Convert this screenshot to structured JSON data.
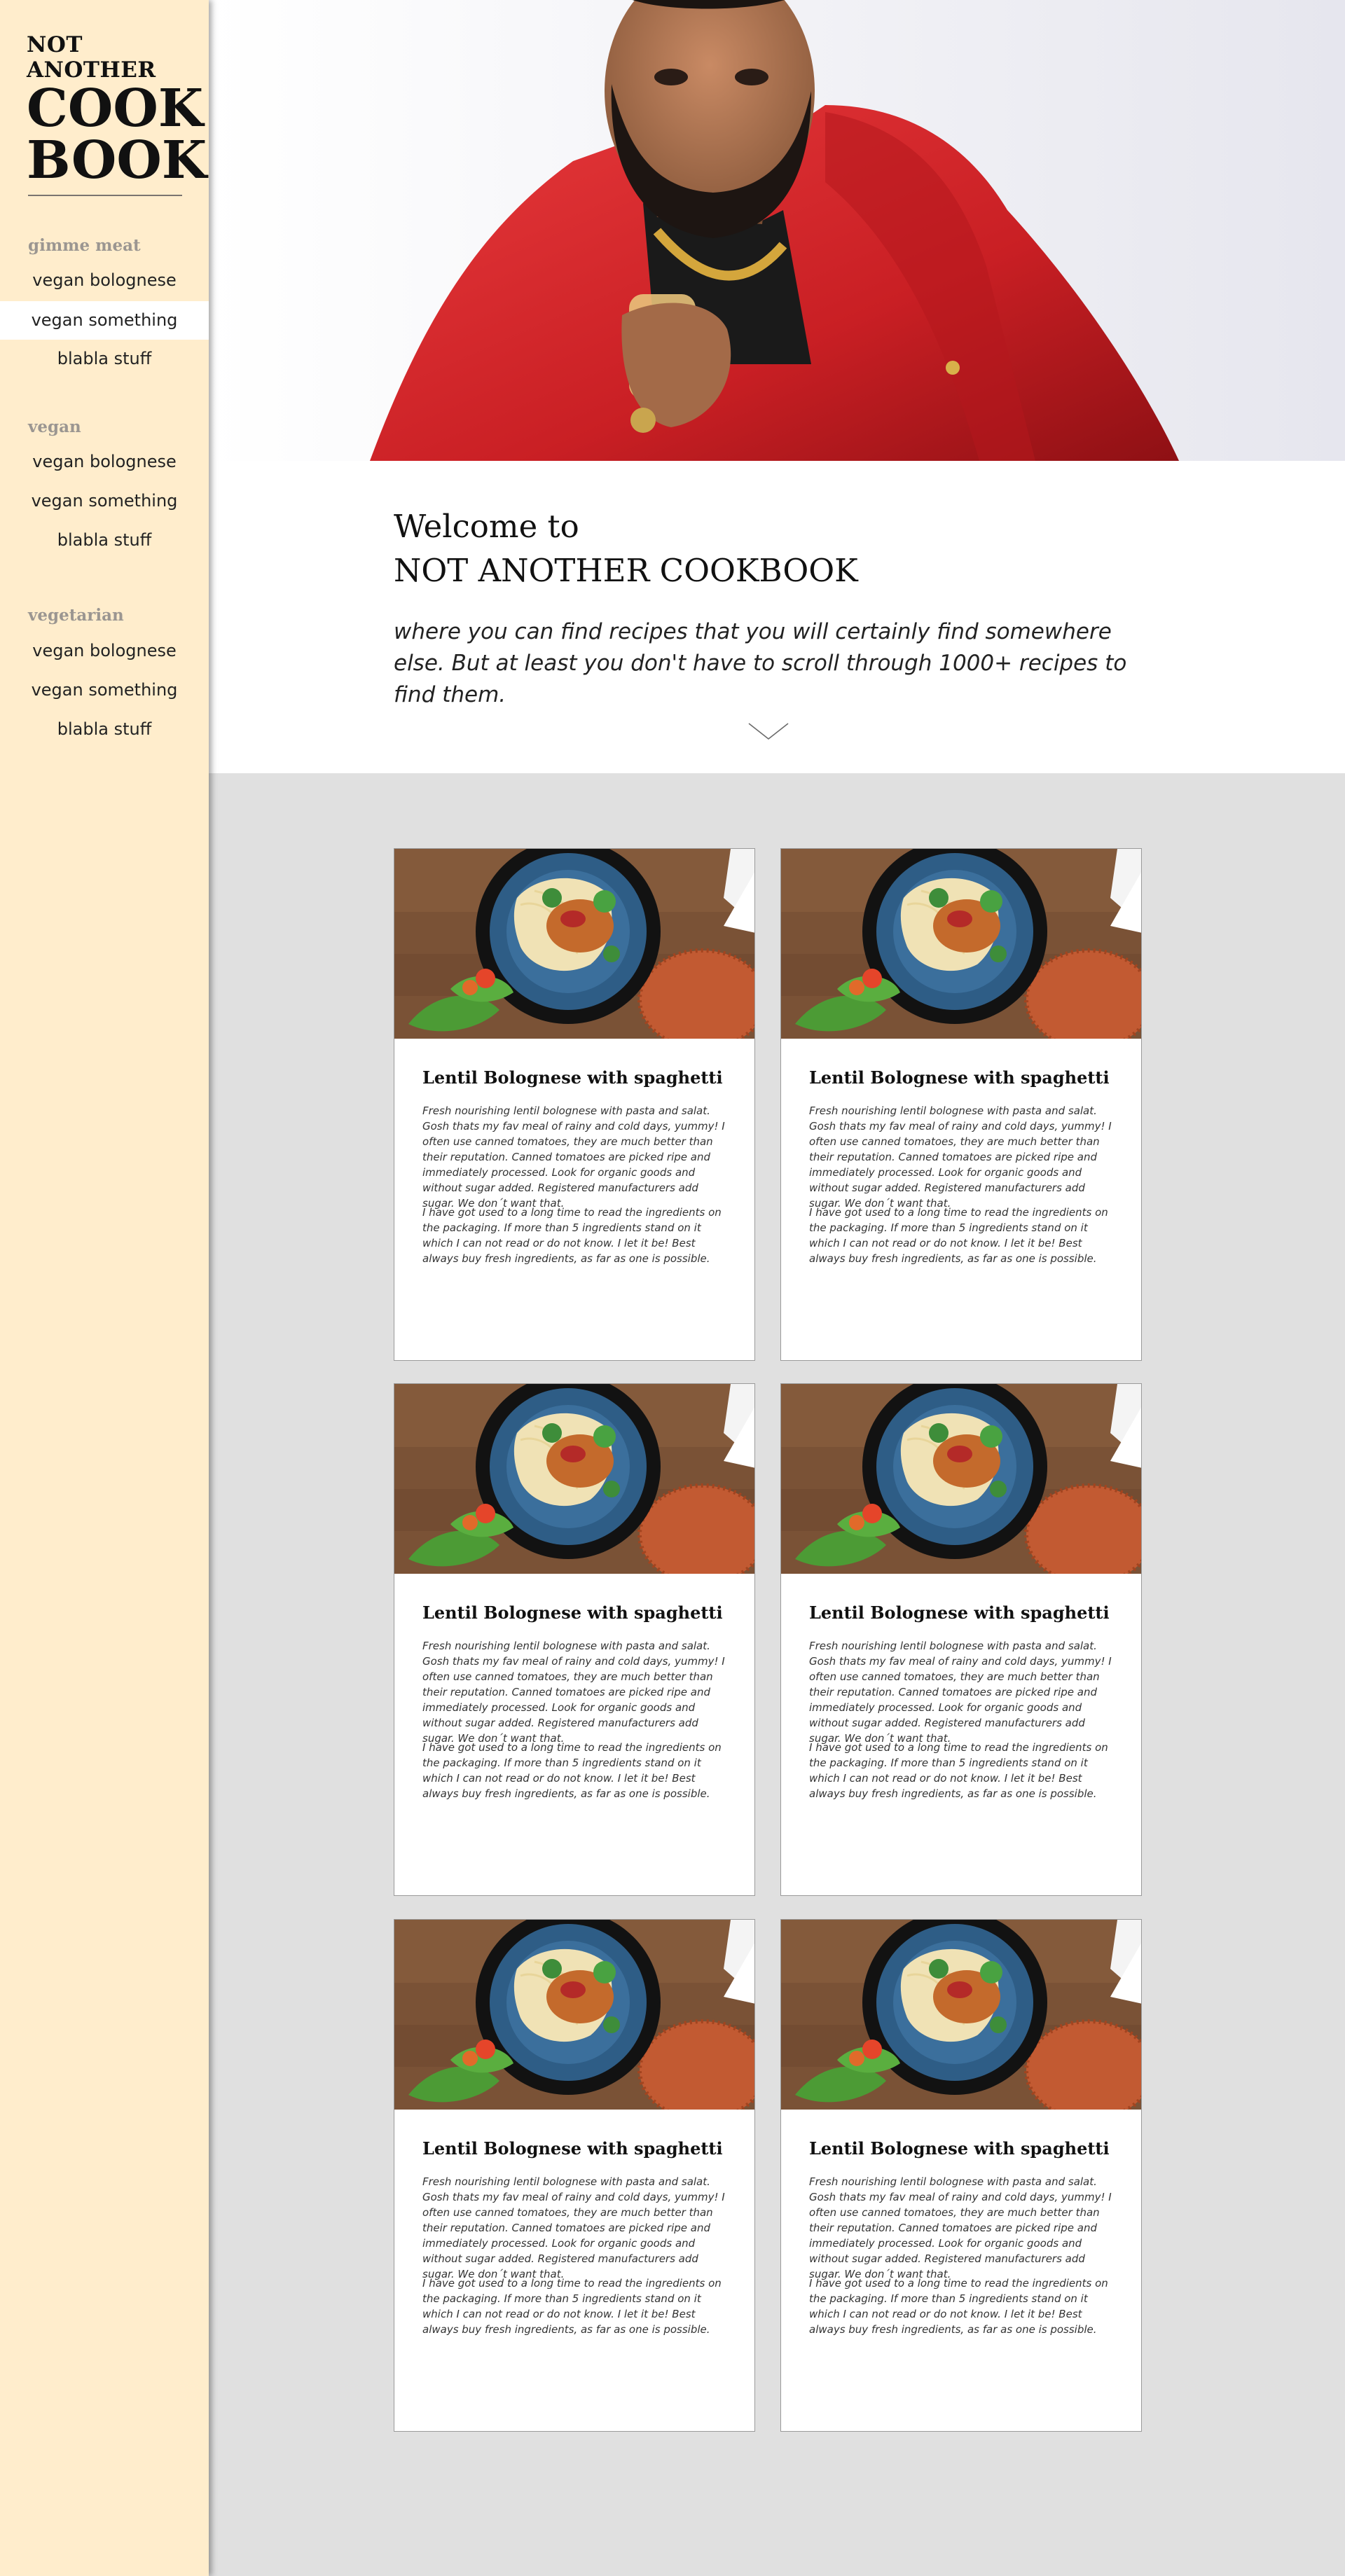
{
  "sidebar": {
    "logo": {
      "line1": "NOT ANOTHER",
      "line2": "COOK",
      "line3": "BOOK"
    },
    "sections": [
      {
        "heading": "gimme meat",
        "items": [
          {
            "label": "vegan bolognese"
          },
          {
            "label": "vegan something"
          },
          {
            "label": "blabla stuff"
          }
        ]
      },
      {
        "heading": "vegan",
        "items": [
          {
            "label": "vegan bolognese"
          },
          {
            "label": "vegan something"
          },
          {
            "label": "blabla stuff"
          }
        ]
      },
      {
        "heading": "vegetarian",
        "items": [
          {
            "label": "vegan bolognese"
          },
          {
            "label": "vegan something"
          },
          {
            "label": "blabla stuff"
          }
        ]
      }
    ],
    "active_item": "vegan something"
  },
  "welcome": {
    "line1": "Welcome to",
    "line2": "NOT ANOTHER COOKBOOK",
    "subtitle": "where you can find recipes that you will certainly find somewhere else. But at least you don't have to scroll through 1000+ recipes to find them."
  },
  "cards": [
    {
      "title": "Lentil Bolognese with spaghetti",
      "p1": "Fresh nourishing lentil bolognese with pasta and salat. Gosh thats my fav meal of rainy and cold days, yummy! I often use canned tomatoes, they are much better than their reputation. Canned tomatoes are picked ripe and immediately processed. Look for organic goods and without sugar added. Registered manufacturers add sugar. We don´t want that.",
      "p2": "I have got used to a long time to read the ingredients on the packaging. If more than 5 ingredients stand on it which I can not read or do not know. I let it be! Best always buy fresh ingredients, as far as one is possible."
    },
    {
      "title": "Lentil Bolognese with spaghetti",
      "p1": "Fresh nourishing lentil bolognese with pasta and salat. Gosh thats my fav meal of rainy and cold days, yummy! I often use canned tomatoes, they are much better than their reputation. Canned tomatoes are picked ripe and immediately processed. Look for organic goods and without sugar added. Registered manufacturers add sugar. We don´t want that.",
      "p2": "I have got used to a long time to read the ingredients on the packaging. If more than 5 ingredients stand on it which I can not read or do not know. I let it be! Best always buy fresh ingredients, as far as one is possible."
    },
    {
      "title": "Lentil Bolognese with spaghetti",
      "p1": "Fresh nourishing lentil bolognese with pasta and salat. Gosh thats my fav meal of rainy and cold days, yummy! I often use canned tomatoes, they are much better than their reputation. Canned tomatoes are picked ripe and immediately processed. Look for organic goods and without sugar added. Registered manufacturers add sugar. We don´t want that.",
      "p2": "I have got used to a long time to read the ingredients on the packaging. If more than 5 ingredients stand on it which I can not read or do not know. I let it be! Best always buy fresh ingredients, as far as one is possible."
    },
    {
      "title": "Lentil Bolognese with spaghetti",
      "p1": "Fresh nourishing lentil bolognese with pasta and salat. Gosh thats my fav meal of rainy and cold days, yummy! I often use canned tomatoes, they are much better than their reputation. Canned tomatoes are picked ripe and immediately processed. Look for organic goods and without sugar added. Registered manufacturers add sugar. We don´t want that.",
      "p2": "I have got used to a long time to read the ingredients on the packaging. If more than 5 ingredients stand on it which I can not read or do not know. I let it be! Best always buy fresh ingredients, as far as one is possible."
    },
    {
      "title": "Lentil Bolognese with spaghetti",
      "p1": "Fresh nourishing lentil bolognese with pasta and salat. Gosh thats my fav meal of rainy and cold days, yummy! I often use canned tomatoes, they are much better than their reputation. Canned tomatoes are picked ripe and immediately processed. Look for organic goods and without sugar added. Registered manufacturers add sugar. We don´t want that.",
      "p2": "I have got used to a long time to read the ingredients on the packaging. If more than 5 ingredients stand on it which I can not read or do not know. I let it be! Best always buy fresh ingredients, as far as one is possible."
    },
    {
      "title": "Lentil Bolognese with spaghetti",
      "p1": "Fresh nourishing lentil bolognese with pasta and salat. Gosh thats my fav meal of rainy and cold days, yummy! I often use canned tomatoes, they are much better than their reputation. Canned tomatoes are picked ripe and immediately processed. Look for organic goods and without sugar added. Registered manufacturers add sugar. We don´t want that.",
      "p2": "I have got used to a long time to read the ingredients on the packaging. If more than 5 ingredients stand on it which I can not read or do not know. I let it be! Best always buy fresh ingredients, as far as one is possible."
    }
  ],
  "colors": {
    "sidebar_bg": "#ffedcc",
    "page_bg": "#e0e0e0",
    "jacket_red": "#d8272b",
    "heading_muted": "#9b9691"
  },
  "icons": {
    "scroll_hint": "chevron-down-icon"
  }
}
